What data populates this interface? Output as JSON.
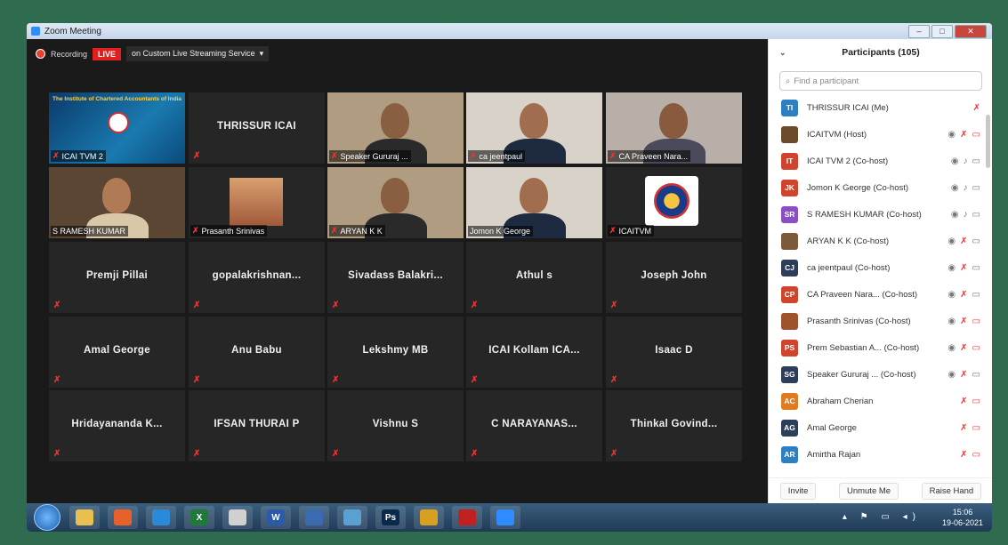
{
  "window": {
    "title": "Zoom Meeting"
  },
  "recording": {
    "label": "Recording",
    "live_badge": "LIVE",
    "stream_service": "on Custom Live Streaming Service",
    "stream_arrow": "▾"
  },
  "tiles": [
    {
      "name": "ICAI TVM 2",
      "video": "banner",
      "banner_line1": "The Institute of Chartered Accountants of India",
      "muted": true,
      "label": true
    },
    {
      "name": "THRISSUR ICAI",
      "video": "none",
      "muted": true,
      "label": false
    },
    {
      "name": "Speaker Gururaj ...",
      "video": "person",
      "muted": true,
      "label": true
    },
    {
      "name": "ca jeentpaul",
      "video": "person",
      "muted": true,
      "label": true
    },
    {
      "name": "CA Praveen Nara...",
      "video": "person",
      "muted": true,
      "label": true
    },
    {
      "name": "S RAMESH KUMAR",
      "video": "person",
      "muted": false,
      "label": true
    },
    {
      "name": "Prasanth Srinivas",
      "video": "photo",
      "muted": true,
      "label": true
    },
    {
      "name": "ARYAN K K",
      "video": "person",
      "muted": true,
      "label": true
    },
    {
      "name": "Jomon K George",
      "video": "person",
      "muted": false,
      "label": true,
      "active": true
    },
    {
      "name": "ICAITVM",
      "video": "logo",
      "muted": true,
      "label": true
    },
    {
      "name": "Premji Pillai",
      "video": "none",
      "muted": true,
      "label": false
    },
    {
      "name": "gopalakrishnan...",
      "video": "none",
      "muted": true,
      "label": false
    },
    {
      "name": "Sivadass  Balakri...",
      "video": "none",
      "muted": true,
      "label": false
    },
    {
      "name": "Athul s",
      "video": "none",
      "muted": true,
      "label": false
    },
    {
      "name": "Joseph John",
      "video": "none",
      "muted": true,
      "label": false
    },
    {
      "name": "Amal George",
      "video": "none",
      "muted": true,
      "label": false
    },
    {
      "name": "Anu Babu",
      "video": "none",
      "muted": true,
      "label": false
    },
    {
      "name": "Lekshmy MB",
      "video": "none",
      "muted": true,
      "label": false
    },
    {
      "name": "ICAI Kollam ICA...",
      "video": "none",
      "muted": true,
      "label": false
    },
    {
      "name": "Isaac D",
      "video": "none",
      "muted": true,
      "label": false
    },
    {
      "name": "Hridayananda  K...",
      "video": "none",
      "muted": true,
      "label": false
    },
    {
      "name": "IFSAN THURAI P",
      "video": "none",
      "muted": true,
      "label": false
    },
    {
      "name": "Vishnu S",
      "video": "none",
      "muted": true,
      "label": false
    },
    {
      "name": "C NARAYANAS...",
      "video": "none",
      "muted": true,
      "label": false
    },
    {
      "name": "Thinkal  Govind...",
      "video": "none",
      "muted": true,
      "label": false
    }
  ],
  "participants": {
    "title": "Participants (105)",
    "collapse_icon": "chevron-down-icon",
    "search_placeholder": "Find a participant",
    "list": [
      {
        "initials": "TI",
        "color": "#2d7fc4",
        "name": "THRISSUR ICAI (Me)",
        "video": false,
        "mic": "muted",
        "cam": "none"
      },
      {
        "initials": "",
        "color": "#6a4a2a",
        "name": "ICAITVM (Host)",
        "video": true,
        "mic": "muted",
        "cam": "off"
      },
      {
        "initials": "IT",
        "color": "#d0432c",
        "name": "ICAI TVM 2 (Co-host)",
        "video": true,
        "mic": "on",
        "cam": "on"
      },
      {
        "initials": "JK",
        "color": "#d0432c",
        "name": "Jomon K George (Co-host)",
        "video": true,
        "mic": "on",
        "cam": "on"
      },
      {
        "initials": "SR",
        "color": "#8a4fc4",
        "name": "S RAMESH KUMAR (Co-host)",
        "video": true,
        "mic": "on",
        "cam": "on"
      },
      {
        "initials": "",
        "color": "#7a5a3a",
        "name": "ARYAN K K (Co-host)",
        "video": true,
        "mic": "muted",
        "cam": "on"
      },
      {
        "initials": "CJ",
        "color": "#2c3e5a",
        "name": "ca jeentpaul (Co-host)",
        "video": true,
        "mic": "muted",
        "cam": "on"
      },
      {
        "initials": "CP",
        "color": "#d0432c",
        "name": "CA Praveen Nara... (Co-host)",
        "video": true,
        "mic": "muted",
        "cam": "on"
      },
      {
        "initials": "",
        "color": "#a0522d",
        "name": "Prasanth Srinivas (Co-host)",
        "video": true,
        "mic": "muted",
        "cam": "off"
      },
      {
        "initials": "PS",
        "color": "#d0432c",
        "name": "Prem Sebastian A... (Co-host)",
        "video": true,
        "mic": "muted",
        "cam": "off"
      },
      {
        "initials": "SG",
        "color": "#2c3e5a",
        "name": "Speaker Gururaj ... (Co-host)",
        "video": true,
        "mic": "muted",
        "cam": "on"
      },
      {
        "initials": "AC",
        "color": "#e07b20",
        "name": "Abraham Cherian",
        "video": false,
        "mic": "muted",
        "cam": "off"
      },
      {
        "initials": "AG",
        "color": "#2c3e5a",
        "name": "Amal George",
        "video": false,
        "mic": "muted",
        "cam": "off"
      },
      {
        "initials": "AR",
        "color": "#2d7fc4",
        "name": "Amirtha Rajan",
        "video": false,
        "mic": "muted",
        "cam": "off"
      }
    ],
    "footer": {
      "invite": "Invite",
      "unmute": "Unmute Me",
      "raise_hand": "Raise Hand"
    }
  },
  "taskbar": {
    "apps": [
      "file-explorer",
      "firefox",
      "edge",
      "excel",
      "paint",
      "word",
      "app",
      "app2",
      "photoshop",
      "chrome",
      "acrobat",
      "zoom"
    ],
    "ps_label": "Ps",
    "word_label": "W",
    "excel_label": "X",
    "time": "15:06",
    "date": "19-06-2021"
  }
}
